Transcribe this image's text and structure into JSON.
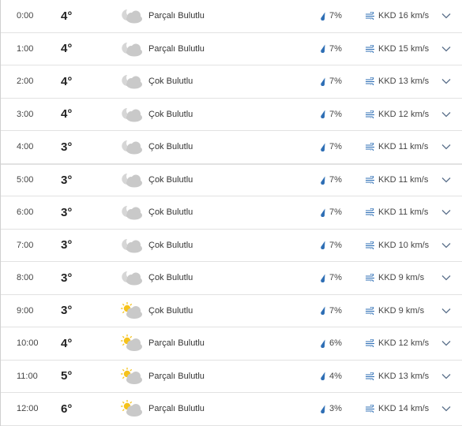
{
  "hourly_forecast": [
    {
      "time": "0:00",
      "temp": "4°",
      "condition": "Parçalı Bulutlu",
      "precip": "7%",
      "wind": "KKD 16 km/s",
      "icon": "moon-cloud-icon"
    },
    {
      "time": "1:00",
      "temp": "4°",
      "condition": "Parçalı Bulutlu",
      "precip": "7%",
      "wind": "KKD 15 km/s",
      "icon": "moon-cloud-icon"
    },
    {
      "time": "2:00",
      "temp": "4°",
      "condition": "Çok Bulutlu",
      "precip": "7%",
      "wind": "KKD 13 km/s",
      "icon": "moon-cloud-icon"
    },
    {
      "time": "3:00",
      "temp": "4°",
      "condition": "Çok Bulutlu",
      "precip": "7%",
      "wind": "KKD 12 km/s",
      "icon": "moon-cloud-icon"
    },
    {
      "time": "4:00",
      "temp": "3°",
      "condition": "Çok Bulutlu",
      "precip": "7%",
      "wind": "KKD 11 km/s",
      "icon": "moon-cloud-icon"
    },
    {
      "time": "5:00",
      "temp": "3°",
      "condition": "Çok Bulutlu",
      "precip": "7%",
      "wind": "KKD 11 km/s",
      "icon": "moon-cloud-icon"
    },
    {
      "time": "6:00",
      "temp": "3°",
      "condition": "Çok Bulutlu",
      "precip": "7%",
      "wind": "KKD 11 km/s",
      "icon": "moon-cloud-icon"
    },
    {
      "time": "7:00",
      "temp": "3°",
      "condition": "Çok Bulutlu",
      "precip": "7%",
      "wind": "KKD 10 km/s",
      "icon": "moon-cloud-icon"
    },
    {
      "time": "8:00",
      "temp": "3°",
      "condition": "Çok Bulutlu",
      "precip": "7%",
      "wind": "KKD 9 km/s",
      "icon": "moon-cloud-icon"
    },
    {
      "time": "9:00",
      "temp": "3°",
      "condition": "Çok Bulutlu",
      "precip": "7%",
      "wind": "KKD 9 km/s",
      "icon": "sun-cloud-icon"
    },
    {
      "time": "10:00",
      "temp": "4°",
      "condition": "Parçalı Bulutlu",
      "precip": "6%",
      "wind": "KKD 12 km/s",
      "icon": "sun-cloud-icon"
    },
    {
      "time": "11:00",
      "temp": "5°",
      "condition": "Parçalı Bulutlu",
      "precip": "4%",
      "wind": "KKD 13 km/s",
      "icon": "sun-cloud-icon"
    },
    {
      "time": "12:00",
      "temp": "6°",
      "condition": "Parçalı Bulutlu",
      "precip": "3%",
      "wind": "KKD 14 km/s",
      "icon": "sun-cloud-icon"
    }
  ],
  "colors": {
    "drop": "#2f6fb5",
    "wind_icon": "#2f6fb5",
    "cloud": "#c9c9c9",
    "sun": "#f5c21b",
    "chevron": "#5a6f8a"
  }
}
